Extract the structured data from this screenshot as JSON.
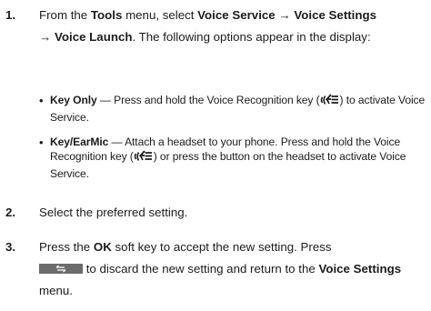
{
  "steps": [
    {
      "number": "1.",
      "parts": [
        "From the ",
        "Tools",
        " menu, select ",
        "Voice Service",
        " → ",
        "Voice Settings",
        " → ",
        "Voice Launch",
        ". The following options appear in the display:"
      ]
    },
    {
      "number": "2.",
      "text": "Select the preferred setting."
    },
    {
      "number": "3.",
      "parts": [
        "Press the ",
        "OK",
        " soft key to accept the new setting. Press ",
        " to discard the new setting and return to the ",
        "Voice Settings",
        " menu."
      ]
    }
  ],
  "options": [
    {
      "bullet": "•",
      "name": "Key Only",
      "dash": " — ",
      "desc_before_icon": "Press and hold the Voice Recognition key (",
      "desc_after_icon": ") to activate Voice Service."
    },
    {
      "bullet": "•",
      "name": "Key/EarMic",
      "dash": " — ",
      "desc_before_icon": "Attach a headset to your phone. Press and hold the Voice Recognition key (",
      "desc_after_icon": ") or press the button on the headset to activate Voice Service."
    }
  ],
  "icons": {
    "voice_key": "voice-recognition-key-icon",
    "back_key": "back-key-icon"
  }
}
